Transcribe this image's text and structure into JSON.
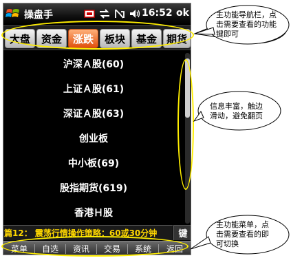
{
  "titlebar": {
    "app_title": "操盘手",
    "time": "16:52",
    "ok_label": "ok"
  },
  "nav_tabs": [
    "大盘",
    "资金",
    "涨跌",
    "板块",
    "基金",
    "期货"
  ],
  "active_tab": "涨跌",
  "list_items": [
    "沪深Ａ股(60)",
    "上证Ａ股(61)",
    "深证Ａ股(63)",
    "创业板",
    "中小板(69)",
    "股指期货(619)",
    "香港Ｈ股"
  ],
  "ticker": {
    "text": "篇12： 震荡行情操作策略：60或30分钟",
    "key_label": "键"
  },
  "menu": [
    "菜单",
    "自选",
    "资讯",
    "交易",
    "系统",
    "返回"
  ],
  "callouts": {
    "top": [
      "主功能导航栏，点",
      "击需要查看的功能",
      "键即可"
    ],
    "middle": [
      "信息丰富，触边",
      "滑动，避免翻页"
    ],
    "bottom": [
      "主功能菜单，点",
      "击需要查看的即",
      "可切换"
    ]
  },
  "colors": {
    "active_tab": "#e0500e",
    "highlight": "#ffee00",
    "ticker_text": "#ffd700"
  }
}
